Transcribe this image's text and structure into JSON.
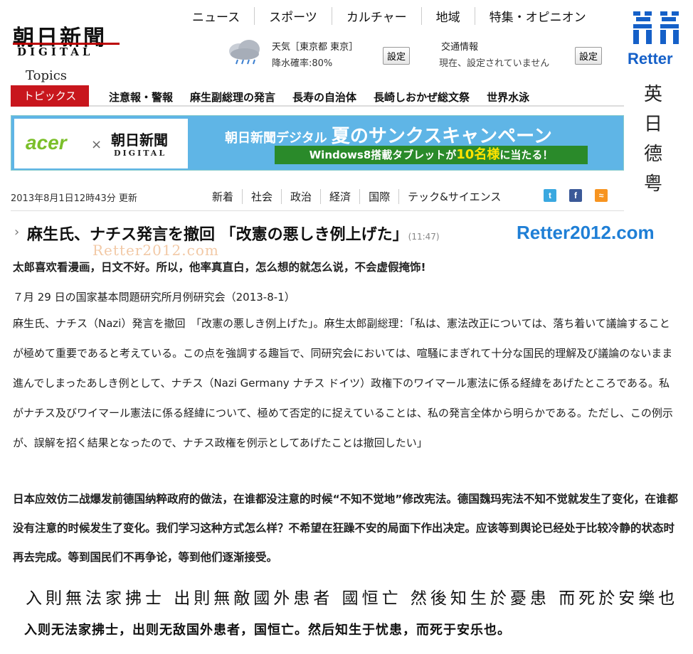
{
  "header": {
    "logo_main": "朝日新聞",
    "logo_sub": "DIGITAL",
    "nav": [
      "ニュース",
      "スポーツ",
      "カルチャー",
      "地域",
      "特集・オピニオン"
    ],
    "weather": {
      "label": "天気［東京都 東京］",
      "rain": "降水確率:80%",
      "set": "設定"
    },
    "traffic": {
      "label": "交通情報",
      "status": "現在、設定されていません",
      "set": "設定"
    }
  },
  "retter": {
    "brand": "Retter",
    "side_chars": [
      "英",
      "日",
      "德",
      "粤"
    ],
    "site": "Retter2012.com",
    "watermark": "Retter2012.com"
  },
  "topics": {
    "title": "Topics",
    "tag": "トピックス",
    "items": [
      "注意報・警報",
      "麻生副総理の発言",
      "長寿の自治体",
      "長崎しおかぜ総文祭",
      "世界水泳"
    ]
  },
  "banner": {
    "acer": "acer",
    "times": "×",
    "logo_main": "朝日新聞",
    "logo_sub": "DIGITAL",
    "line1_prefix": "朝日新聞デジタル",
    "line1_main": "夏のサンクスキャンペーン",
    "line2_prefix": "Windows8搭載タブレットが",
    "line2_num": "10名様",
    "line2_suffix": "に当たる！"
  },
  "meta": {
    "date": "2013年8月1日12時43分 更新",
    "categories": [
      "新着",
      "社会",
      "政治",
      "経済",
      "国際",
      "テック&サイエンス"
    ]
  },
  "article": {
    "headline": "麻生氏、ナチス発言を撤回 「改憲の悪しき例上げた」",
    "time": "(11:47)",
    "intro": "太郎喜欢看漫画，日文不好。所以，他率真直白，怎么想的就怎么说，不会虚假掩饰!",
    "subhead": "７月 29 日の国家基本問題研究所月例研究会（2013-8-1）",
    "body": "麻生氏、ナチス（Nazi）発言を撤回　「改憲の悪しき例上げた」。麻生太郎副総理：「私は、憲法改正については、落ち着いて議論することが極めて重要であると考えている。この点を強調する趣旨で、同研究会においては、喧騒にまぎれて十分な国民的理解及び議論のないまま進んでしまったあしき例として、ナチス（Nazi Germany ナチス ドイツ）政権下のワイマール憲法に係る経緯をあげたところである。私がナチス及びワイマール憲法に係る経緯について、極めて否定的に捉えていることは、私の発言全体から明らかである。ただし、この例示が、誤解を招く結果となったので、ナチス政権を例示としてあげたことは撤回したい」",
    "commentary": "日本应效仿二战爆发前德国纳粹政府的做法，在谁都没注意的时候“不知不觉地”修改宪法。德国魏玛宪法不知不觉就发生了变化，在谁都没有注意的时候发生了变化。我们学习这种方式怎么样？不希望在狂躁不安的局面下作出决定。应该等到舆论已经处于比较冷静的状态时再去完成。等到国民们不再争论，等到他们逐渐接受。",
    "seal_script": "入則無法家拂士 出則無敵國外患者 國恒亡 然後知生於憂患 而死於安樂也",
    "quote": "入则无法家拂士，出则无敌国外患者，国恒亡。然后知生于忧患，而死于安乐也。"
  }
}
